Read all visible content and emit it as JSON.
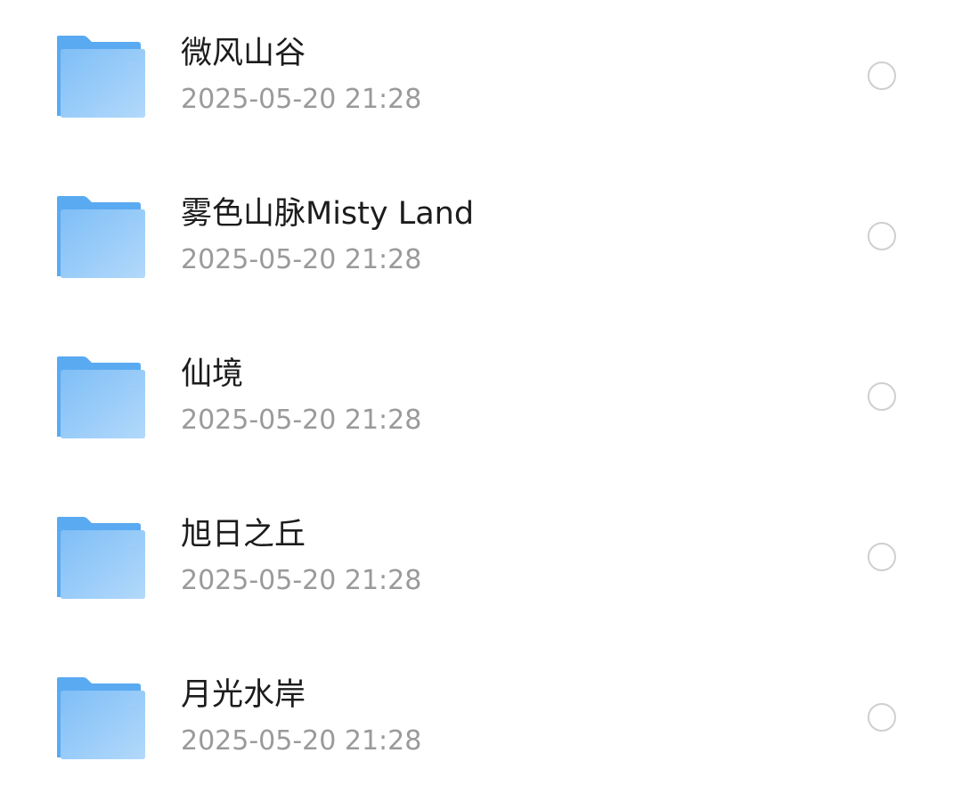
{
  "files": [
    {
      "name": "微风山谷",
      "date": "2025-05-20 21:28",
      "icon": "folder-icon",
      "selected": false
    },
    {
      "name": "雾色山脉Misty Land",
      "date": "2025-05-20 21:28",
      "icon": "folder-icon",
      "selected": false
    },
    {
      "name": "仙境",
      "date": "2025-05-20 21:28",
      "icon": "folder-icon",
      "selected": false
    },
    {
      "name": "旭日之丘",
      "date": "2025-05-20 21:28",
      "icon": "folder-icon",
      "selected": false
    },
    {
      "name": "月光水岸",
      "date": "2025-05-20 21:28",
      "icon": "folder-icon",
      "selected": false
    }
  ],
  "colors": {
    "folder_back": "#5aaaf1",
    "folder_front_start": "#7fbef6",
    "folder_front_end": "#b2d9fb",
    "name_text": "#1c1c1c",
    "date_text": "#9a9a9a",
    "radio_border": "#cfcfcf"
  }
}
